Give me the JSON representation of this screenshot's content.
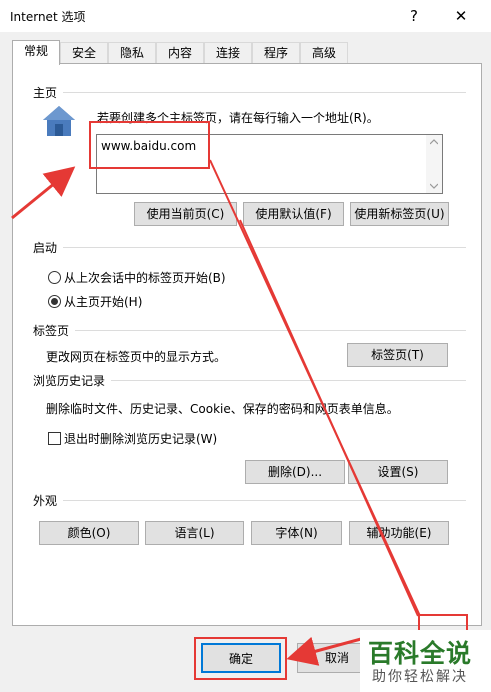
{
  "window": {
    "title": "Internet 选项",
    "help": "?",
    "close": "✕"
  },
  "tabs": [
    "常规",
    "安全",
    "隐私",
    "内容",
    "连接",
    "程序",
    "高级"
  ],
  "homepage": {
    "label": "主页",
    "instructions": "若要创建多个主标签页，请在每行输入一个地址(R)。",
    "url": "www.baidu.com",
    "buttons": [
      "使用当前页(C)",
      "使用默认值(F)",
      "使用新标签页(U)"
    ]
  },
  "startup": {
    "label": "启动",
    "options": [
      "从上次会话中的标签页开始(B)",
      "从主页开始(H)"
    ],
    "selected": 1
  },
  "tabs_section": {
    "label": "标签页",
    "description": "更改网页在标签页中的显示方式。",
    "button": "标签页(T)"
  },
  "history": {
    "label": "浏览历史记录",
    "description": "删除临时文件、历史记录、Cookie、保存的密码和网页表单信息。",
    "checkbox": "退出时删除浏览历史记录(W)",
    "checked": false,
    "buttons": [
      "删除(D)...",
      "设置(S)"
    ]
  },
  "appearance": {
    "label": "外观",
    "buttons": [
      "颜色(O)",
      "语言(L)",
      "字体(N)",
      "辅助功能(E)"
    ]
  },
  "footer": {
    "ok": "确定",
    "cancel": "取消"
  },
  "watermark": {
    "title": "百科全说",
    "subtitle": "助你轻松解决"
  }
}
